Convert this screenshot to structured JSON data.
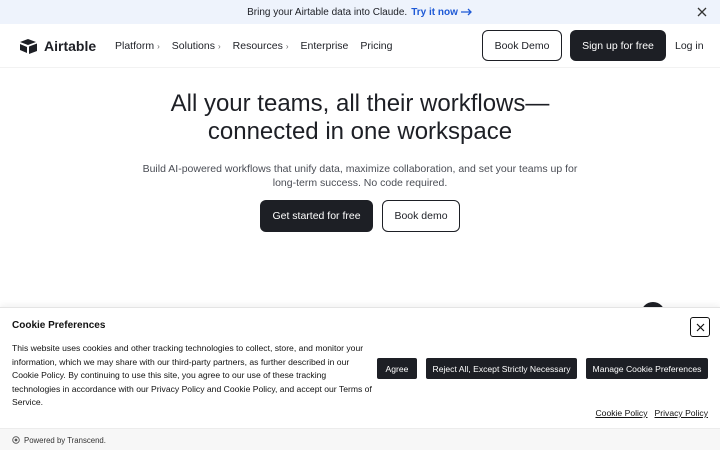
{
  "banner": {
    "text": "Bring your Airtable data into Claude.",
    "cta": "Try it now",
    "arrow_icon": "arrow-right-icon",
    "close_icon": "close-icon"
  },
  "header": {
    "logo_text": "Airtable",
    "nav": [
      {
        "label": "Platform",
        "chevron": "›"
      },
      {
        "label": "Solutions",
        "chevron": "›"
      },
      {
        "label": "Resources",
        "chevron": "›"
      },
      {
        "label": "Enterprise",
        "chevron": ""
      },
      {
        "label": "Pricing",
        "chevron": ""
      }
    ],
    "book_demo": "Book Demo",
    "sign_up": "Sign up for free",
    "log_in": "Log in"
  },
  "hero": {
    "title_line1": "All your teams, all their workflows—",
    "title_line2": "connected in one workspace",
    "subtitle": "Build AI-powered workflows that unify data, maximize collaboration, and set your teams up for long-term success. No code required.",
    "primary_cta": "Get started for free",
    "secondary_cta": "Book demo"
  },
  "cookie": {
    "title": "Cookie Preferences",
    "body": "This website uses cookies and other tracking technologies to collect, store, and monitor your information, which we may share with our third-party partners, as further described in our Cookie Policy. By continuing to use this site, you agree to our use of these tracking technologies in accordance with our Privacy Policy and Cookie Policy, and accept our Terms of Service.",
    "agree": "Agree",
    "reject": "Reject All, Except Strictly Necessary",
    "manage": "Manage Cookie Preferences",
    "link_cookie_policy": "Cookie Policy",
    "link_privacy_policy": "Privacy Policy",
    "powered_by": "Powered by Transcend."
  },
  "colors": {
    "banner_bg": "#eef3fc",
    "link_blue": "#1f5ad6",
    "dark": "#1d1f25"
  }
}
